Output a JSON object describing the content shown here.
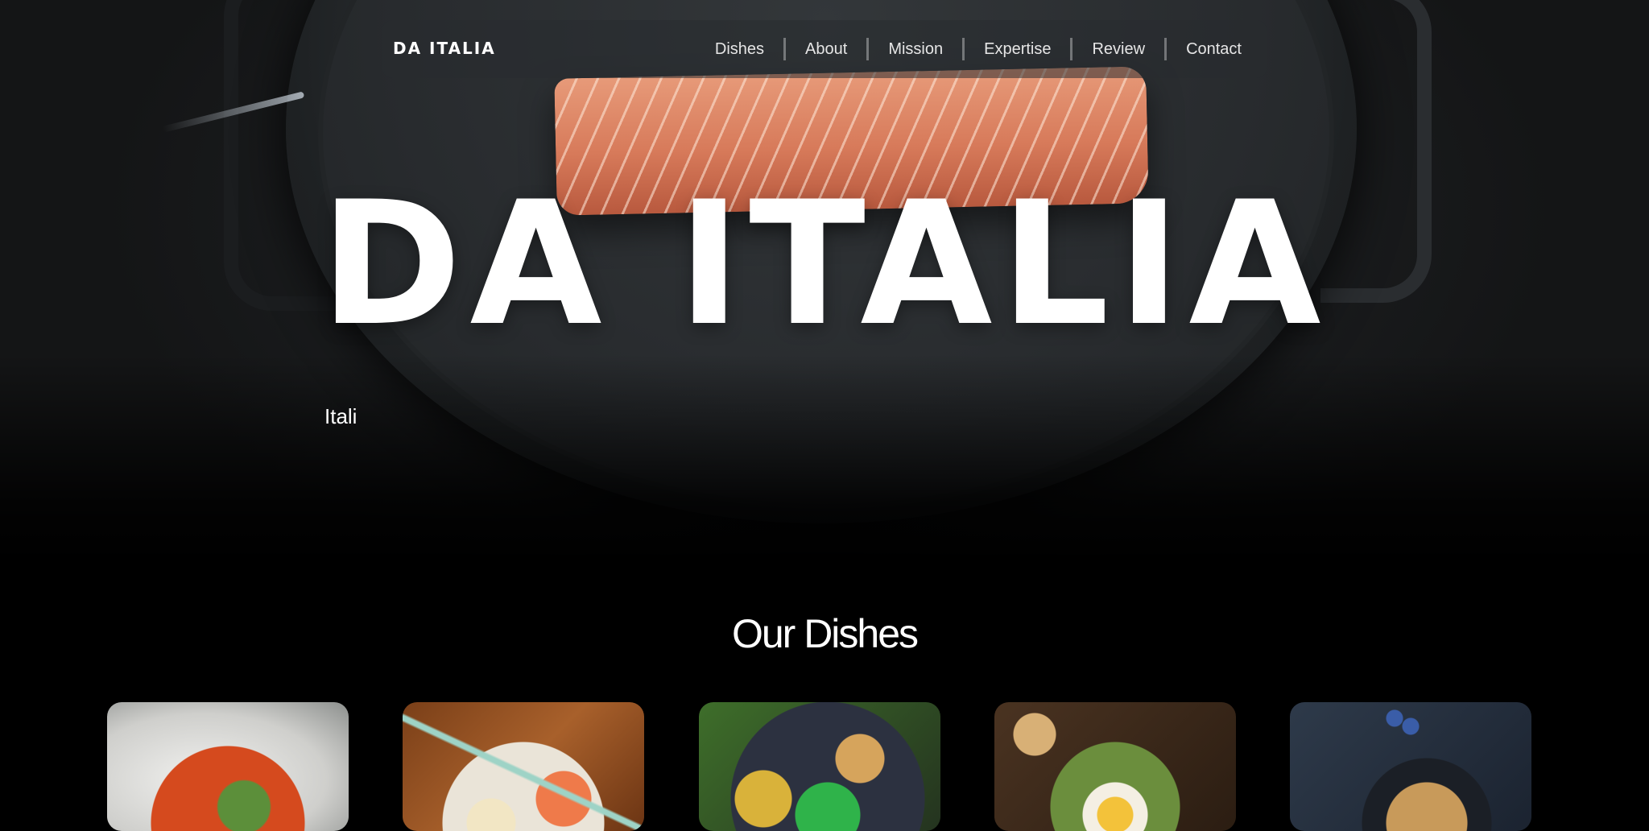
{
  "nav": {
    "logo": "DA ITALIA",
    "items": [
      {
        "label": "Dishes"
      },
      {
        "label": "About"
      },
      {
        "label": "Mission"
      },
      {
        "label": "Expertise"
      },
      {
        "label": "Review"
      },
      {
        "label": "Contact"
      }
    ]
  },
  "hero": {
    "title": "DA ITALIA",
    "subtitle": "Itali"
  },
  "dishes": {
    "title": "Our Dishes",
    "cards": [
      {
        "icon": "dish-photo"
      },
      {
        "icon": "dish-photo"
      },
      {
        "icon": "dish-photo"
      },
      {
        "icon": "dish-photo"
      },
      {
        "icon": "dish-photo"
      }
    ]
  }
}
